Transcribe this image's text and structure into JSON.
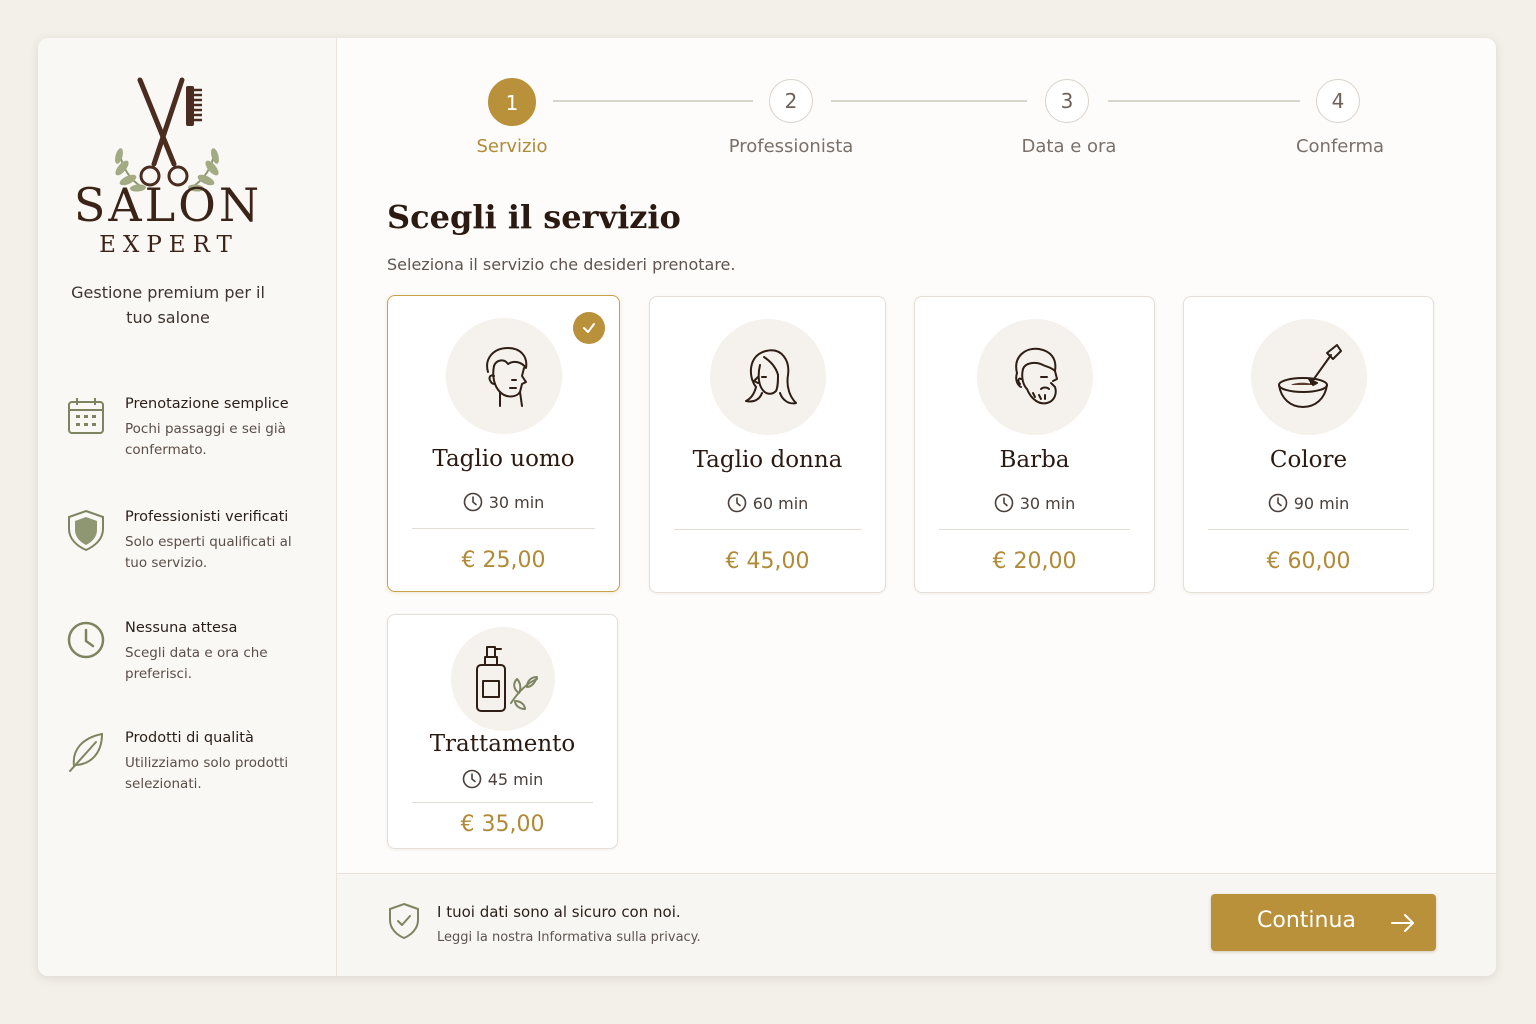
{
  "brand": {
    "name": "SALON",
    "sub": "EXPERT",
    "tagline": "Gestione premium per il tuo salone",
    "logo_icon": "scissors-comb-laurel-icon"
  },
  "features": [
    {
      "icon": "calendar-icon",
      "title": "Prenotazione semplice",
      "desc": "Pochi passaggi e sei già confermato."
    },
    {
      "icon": "shield-icon",
      "title": "Professionisti verificati",
      "desc": "Solo esperti qualificati al tuo servizio."
    },
    {
      "icon": "clock-icon",
      "title": "Nessuna attesa",
      "desc": "Scegli data e ora che preferisci."
    },
    {
      "icon": "leaf-icon",
      "title": "Prodotti di qualità",
      "desc": "Utilizziamo solo prodotti selezionati."
    }
  ],
  "steps": [
    {
      "number": "1",
      "label": "Servizio",
      "active": true
    },
    {
      "number": "2",
      "label": "Professionista",
      "active": false
    },
    {
      "number": "3",
      "label": "Data e ora",
      "active": false
    },
    {
      "number": "4",
      "label": "Conferma",
      "active": false
    }
  ],
  "main": {
    "title": "Scegli il servizio",
    "subtitle": "Seleziona il servizio che desideri prenotare."
  },
  "services": [
    {
      "name": "Taglio uomo",
      "duration": "30 min",
      "price": "€ 25,00",
      "icon": "man-head-icon",
      "selected": true
    },
    {
      "name": "Taglio donna",
      "duration": "60 min",
      "price": "€ 45,00",
      "icon": "woman-head-icon",
      "selected": false
    },
    {
      "name": "Barba",
      "duration": "30 min",
      "price": "€ 20,00",
      "icon": "beard-icon",
      "selected": false
    },
    {
      "name": "Colore",
      "duration": "90 min",
      "price": "€ 60,00",
      "icon": "color-bowl-brush-icon",
      "selected": false
    },
    {
      "name": "Trattamento",
      "duration": "45 min",
      "price": "€ 35,00",
      "icon": "bottle-leaf-icon",
      "selected": false
    }
  ],
  "footer": {
    "secure_title": "I tuoi dati sono al sicuro con noi.",
    "secure_desc": "Leggi la nostra Informativa sulla privacy.",
    "continue_label": "Continua"
  },
  "colors": {
    "accent": "#b8913a",
    "text_dark": "#2a1a12",
    "muted": "#5e5550",
    "olive": "#7d8560"
  }
}
